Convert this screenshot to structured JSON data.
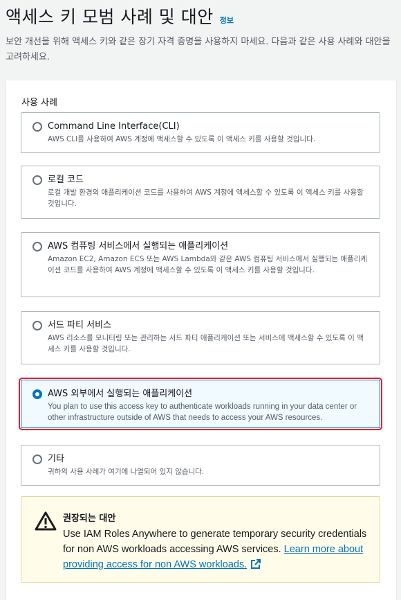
{
  "header": {
    "title": "액세스 키 모범 사례 및 대안",
    "info_link": "정보",
    "description": "보안 개선을 위해 액세스 키와 같은 장기 자격 증명을 사용하지 마세요. 다음과 같은 사용 사례와 대안을 고려하세요."
  },
  "use_cases": {
    "label": "사용 사례",
    "selected_index": 4,
    "options": [
      {
        "title": "Command Line Interface(CLI)",
        "description": "AWS CLI를 사용하여 AWS 계정에 액세스할 수 있도록 이 액세스 키를 사용할 것입니다."
      },
      {
        "title": "로컬 코드",
        "description": "로컬 개발 환경의 애플리케이션 코드를 사용하여 AWS 계정에 액세스할 수 있도록 이 액세스 키를 사용할 것입니다."
      },
      {
        "title": "AWS 컴퓨팅 서비스에서 실행되는 애플리케이션",
        "description": "Amazon EC2, Amazon ECS 또는 AWS Lambda와 같은 AWS 컴퓨팅 서비스에서 실행되는 애플리케이션 코드를 사용하여 AWS 계정에 액세스할 수 있도록 이 액세스 키를 사용할 것입니다."
      },
      {
        "title": "서드 파티 서비스",
        "description": "AWS 리소스를 모니터링 또는 관리하는 서드 파티 애플리케이션 또는 서비스에 액세스할 수 있도록 이 액세스 키를 사용할 것입니다."
      },
      {
        "title": "AWS 외부에서 실행되는 애플리케이션",
        "description": "You plan to use this access key to authenticate workloads running in your data center or other infrastructure outside of AWS that needs to access your AWS resources."
      },
      {
        "title": "기타",
        "description": "귀하의 사용 사례가 여기에 나열되어 있지 않습니다."
      }
    ]
  },
  "alert": {
    "type": "warning",
    "title": "권장되는 대안",
    "body": "Use IAM Roles Anywhere to generate temporary security credentials for non AWS workloads accessing AWS services.",
    "link_text": "Learn more about providing access for non AWS workloads."
  },
  "colors": {
    "accent": "#0073bb",
    "selected_outline": "#e0202e",
    "warning_bg": "#fffce9",
    "warning_icon": "#1d1d1d"
  }
}
